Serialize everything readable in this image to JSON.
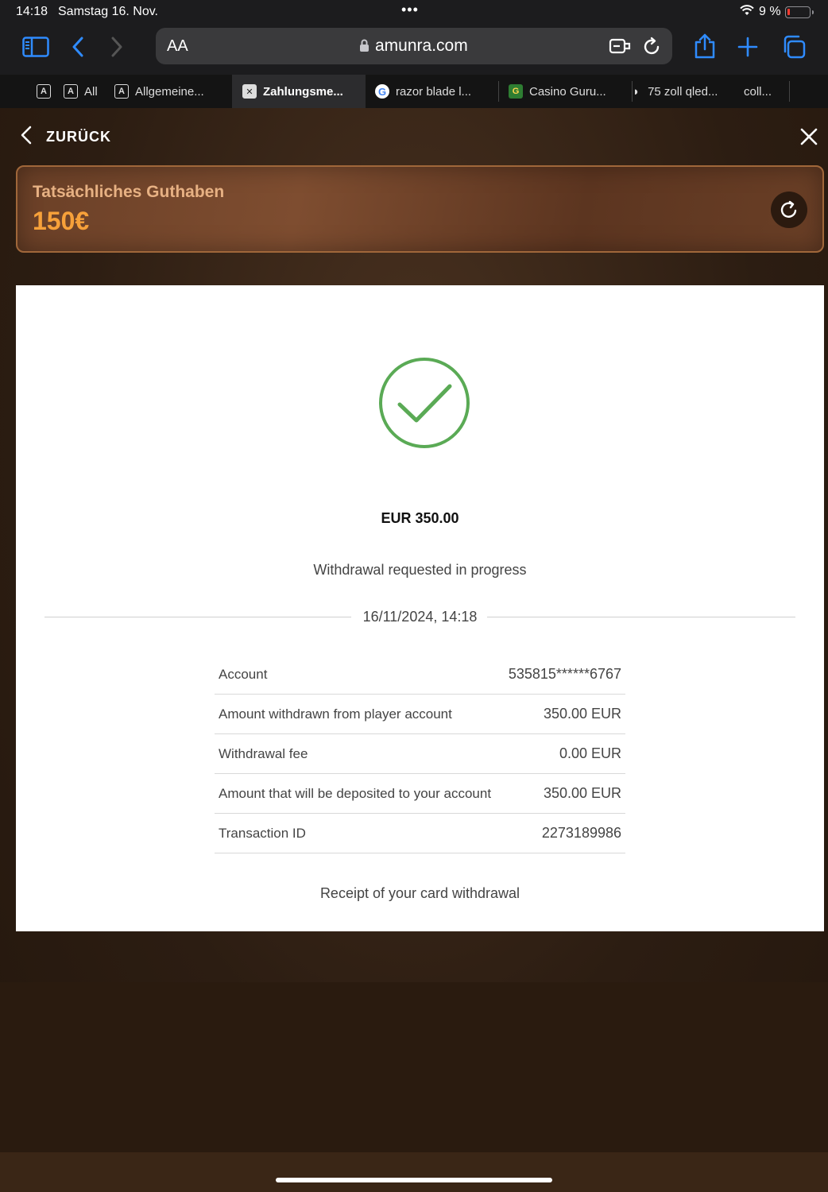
{
  "status_bar": {
    "time": "14:18",
    "date": "Samstag 16. Nov.",
    "battery_percent": "9 %"
  },
  "browser": {
    "aa_label": "AA",
    "domain": "amunra.com",
    "tabs": [
      {
        "label": "All"
      },
      {
        "label": "Allgemeine..."
      },
      {
        "label": "Zahlungsme..."
      },
      {
        "label": "razor blade l..."
      },
      {
        "label": "Casino Guru..."
      },
      {
        "label": "75 zoll qled..."
      },
      {
        "label": "coll..."
      }
    ]
  },
  "page": {
    "back_label": "ZURÜCK",
    "balance_label": "Tatsächliches Guthaben",
    "balance_value": "150€"
  },
  "receipt": {
    "amount": "EUR 350.00",
    "status": "Withdrawal requested in progress",
    "datetime": "16/11/2024, 14:18",
    "rows": [
      {
        "label": "Account",
        "value": "535815******6767"
      },
      {
        "label": "Amount withdrawn from player account",
        "value": "350.00 EUR"
      },
      {
        "label": "Withdrawal fee",
        "value": "0.00 EUR"
      },
      {
        "label": "Amount that will be deposited to your account",
        "value": "350.00 EUR"
      },
      {
        "label": "Transaction ID",
        "value": "2273189986"
      }
    ],
    "footer": "Receipt of your card withdrawal"
  },
  "colors": {
    "accent": "#f7a13a",
    "success": "#5aaa55",
    "browser_blue": "#2f8bff"
  }
}
